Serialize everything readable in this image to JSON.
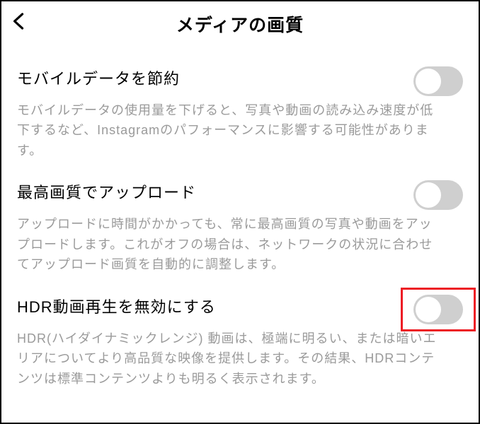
{
  "header": {
    "title": "メディアの画質"
  },
  "settings": {
    "data_saver": {
      "title": "モバイルデータを節約",
      "description": "モバイルデータの使用量を下げると、写真や動画の読み込み速度が低下するなど、Instagramのパフォーマンスに影響する可能性があります。"
    },
    "upload_highest": {
      "title": "最高画質でアップロード",
      "description": "アップロードに時間がかかっても、常に最高画質の写真や動画をアップロードします。これがオフの場合は、ネットワークの状況に合わせてアップロード画質を自動的に調整します。"
    },
    "disable_hdr": {
      "title": "HDR動画再生を無効にする",
      "description": "HDR(ハイダイナミックレンジ) 動画は、極端に明るい、または暗いエリアについてより高品質な映像を提供します。その結果、HDRコンテンツは標準コンテンツよりも明るく表示されます。"
    }
  }
}
